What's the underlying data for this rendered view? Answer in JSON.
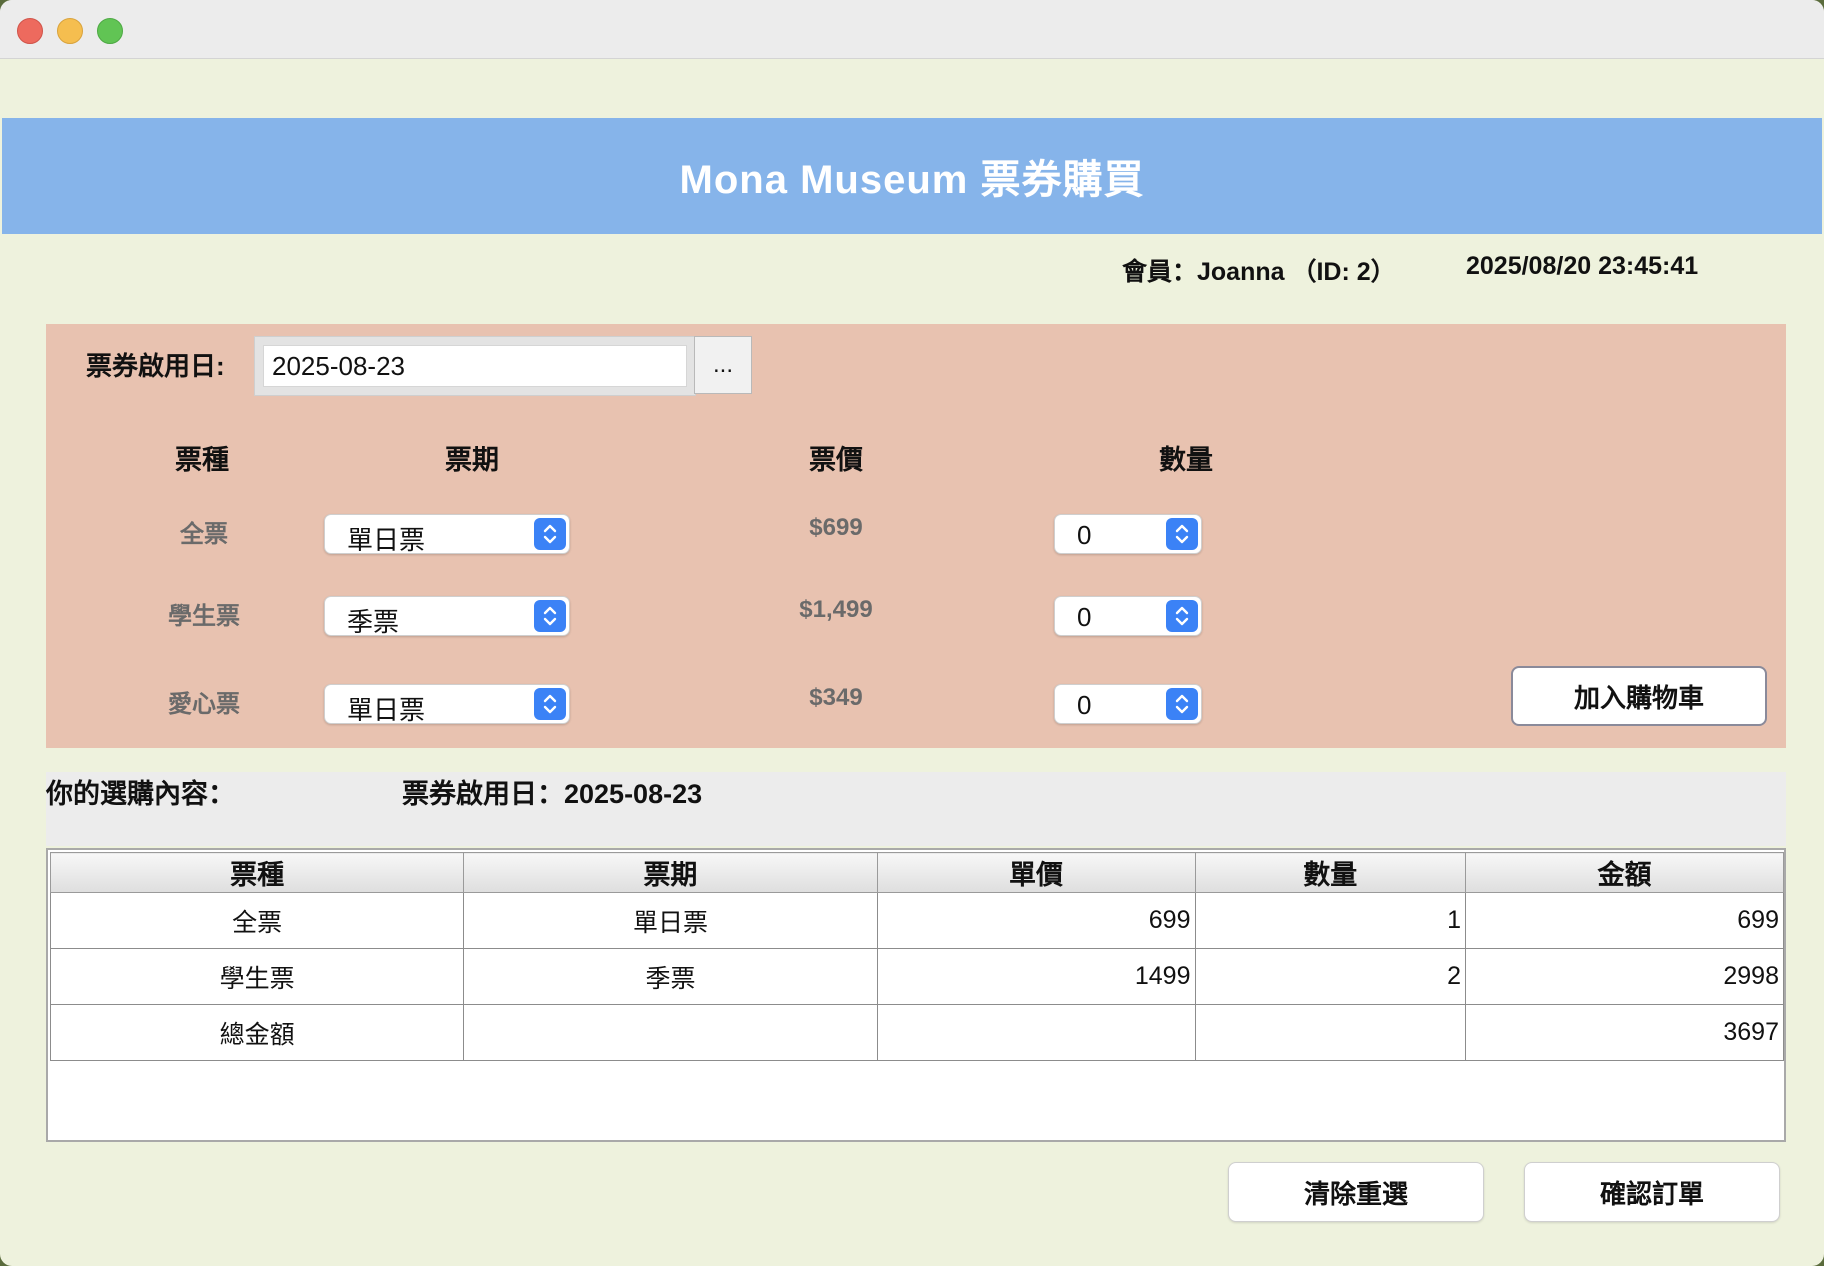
{
  "window": {
    "title": ""
  },
  "header": {
    "title": "Mona Museum 票券購買"
  },
  "status": {
    "member": "會員：Joanna （ID: 2）",
    "datetime": "2025/08/20 23:45:41"
  },
  "form": {
    "start_date_label": "票券啟用日:",
    "start_date_value": "2025-08-23",
    "date_picker_label": "...",
    "columns": {
      "type": "票種",
      "period": "票期",
      "price": "票價",
      "quantity": "數量"
    },
    "rows": [
      {
        "type": "全票",
        "period": "單日票",
        "price": "$699",
        "quantity": "0"
      },
      {
        "type": "學生票",
        "period": "季票",
        "price": "$1,499",
        "quantity": "0"
      },
      {
        "type": "愛心票",
        "period": "單日票",
        "price": "$349",
        "quantity": "0"
      }
    ],
    "add_to_cart": "加入購物車"
  },
  "summary": {
    "label": "你的選購內容：",
    "start_date": "票券啟用日：2025-08-23"
  },
  "table": {
    "headers": [
      "票種",
      "票期",
      "單價",
      "數量",
      "金額"
    ],
    "rows": [
      [
        "全票",
        "單日票",
        "699",
        "1",
        "699"
      ],
      [
        "學生票",
        "季票",
        "1499",
        "2",
        "2998"
      ],
      [
        "總金額",
        "",
        "",
        "",
        "3697"
      ]
    ]
  },
  "actions": {
    "clear": "清除重選",
    "confirm": "確認訂單"
  },
  "colors": {
    "banner": "#86b4ea",
    "panel": "#e8c2b0",
    "background": "#eef2dd",
    "select_accent": "#3b82f6"
  }
}
